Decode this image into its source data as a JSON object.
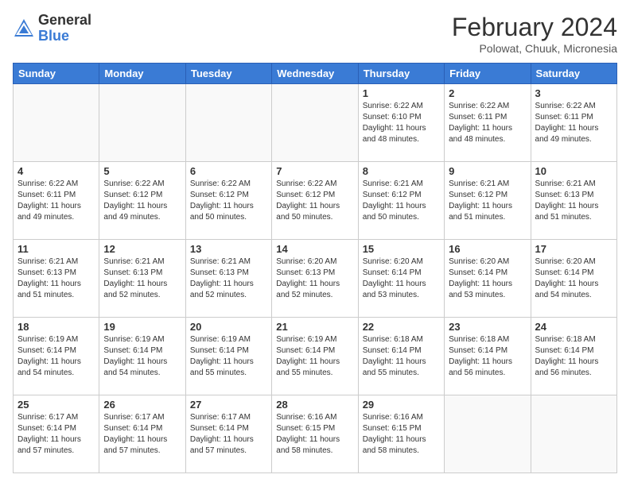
{
  "logo": {
    "general": "General",
    "blue": "Blue"
  },
  "title": {
    "month_year": "February 2024",
    "location": "Polowat, Chuuk, Micronesia"
  },
  "days_of_week": [
    "Sunday",
    "Monday",
    "Tuesday",
    "Wednesday",
    "Thursday",
    "Friday",
    "Saturday"
  ],
  "weeks": [
    [
      {
        "day": "",
        "content": ""
      },
      {
        "day": "",
        "content": ""
      },
      {
        "day": "",
        "content": ""
      },
      {
        "day": "",
        "content": ""
      },
      {
        "day": "1",
        "content": "Sunrise: 6:22 AM\nSunset: 6:10 PM\nDaylight: 11 hours and 48 minutes."
      },
      {
        "day": "2",
        "content": "Sunrise: 6:22 AM\nSunset: 6:11 PM\nDaylight: 11 hours and 48 minutes."
      },
      {
        "day": "3",
        "content": "Sunrise: 6:22 AM\nSunset: 6:11 PM\nDaylight: 11 hours and 49 minutes."
      }
    ],
    [
      {
        "day": "4",
        "content": "Sunrise: 6:22 AM\nSunset: 6:11 PM\nDaylight: 11 hours and 49 minutes."
      },
      {
        "day": "5",
        "content": "Sunrise: 6:22 AM\nSunset: 6:12 PM\nDaylight: 11 hours and 49 minutes."
      },
      {
        "day": "6",
        "content": "Sunrise: 6:22 AM\nSunset: 6:12 PM\nDaylight: 11 hours and 50 minutes."
      },
      {
        "day": "7",
        "content": "Sunrise: 6:22 AM\nSunset: 6:12 PM\nDaylight: 11 hours and 50 minutes."
      },
      {
        "day": "8",
        "content": "Sunrise: 6:21 AM\nSunset: 6:12 PM\nDaylight: 11 hours and 50 minutes."
      },
      {
        "day": "9",
        "content": "Sunrise: 6:21 AM\nSunset: 6:12 PM\nDaylight: 11 hours and 51 minutes."
      },
      {
        "day": "10",
        "content": "Sunrise: 6:21 AM\nSunset: 6:13 PM\nDaylight: 11 hours and 51 minutes."
      }
    ],
    [
      {
        "day": "11",
        "content": "Sunrise: 6:21 AM\nSunset: 6:13 PM\nDaylight: 11 hours and 51 minutes."
      },
      {
        "day": "12",
        "content": "Sunrise: 6:21 AM\nSunset: 6:13 PM\nDaylight: 11 hours and 52 minutes."
      },
      {
        "day": "13",
        "content": "Sunrise: 6:21 AM\nSunset: 6:13 PM\nDaylight: 11 hours and 52 minutes."
      },
      {
        "day": "14",
        "content": "Sunrise: 6:20 AM\nSunset: 6:13 PM\nDaylight: 11 hours and 52 minutes."
      },
      {
        "day": "15",
        "content": "Sunrise: 6:20 AM\nSunset: 6:14 PM\nDaylight: 11 hours and 53 minutes."
      },
      {
        "day": "16",
        "content": "Sunrise: 6:20 AM\nSunset: 6:14 PM\nDaylight: 11 hours and 53 minutes."
      },
      {
        "day": "17",
        "content": "Sunrise: 6:20 AM\nSunset: 6:14 PM\nDaylight: 11 hours and 54 minutes."
      }
    ],
    [
      {
        "day": "18",
        "content": "Sunrise: 6:19 AM\nSunset: 6:14 PM\nDaylight: 11 hours and 54 minutes."
      },
      {
        "day": "19",
        "content": "Sunrise: 6:19 AM\nSunset: 6:14 PM\nDaylight: 11 hours and 54 minutes."
      },
      {
        "day": "20",
        "content": "Sunrise: 6:19 AM\nSunset: 6:14 PM\nDaylight: 11 hours and 55 minutes."
      },
      {
        "day": "21",
        "content": "Sunrise: 6:19 AM\nSunset: 6:14 PM\nDaylight: 11 hours and 55 minutes."
      },
      {
        "day": "22",
        "content": "Sunrise: 6:18 AM\nSunset: 6:14 PM\nDaylight: 11 hours and 55 minutes."
      },
      {
        "day": "23",
        "content": "Sunrise: 6:18 AM\nSunset: 6:14 PM\nDaylight: 11 hours and 56 minutes."
      },
      {
        "day": "24",
        "content": "Sunrise: 6:18 AM\nSunset: 6:14 PM\nDaylight: 11 hours and 56 minutes."
      }
    ],
    [
      {
        "day": "25",
        "content": "Sunrise: 6:17 AM\nSunset: 6:14 PM\nDaylight: 11 hours and 57 minutes."
      },
      {
        "day": "26",
        "content": "Sunrise: 6:17 AM\nSunset: 6:14 PM\nDaylight: 11 hours and 57 minutes."
      },
      {
        "day": "27",
        "content": "Sunrise: 6:17 AM\nSunset: 6:14 PM\nDaylight: 11 hours and 57 minutes."
      },
      {
        "day": "28",
        "content": "Sunrise: 6:16 AM\nSunset: 6:15 PM\nDaylight: 11 hours and 58 minutes."
      },
      {
        "day": "29",
        "content": "Sunrise: 6:16 AM\nSunset: 6:15 PM\nDaylight: 11 hours and 58 minutes."
      },
      {
        "day": "",
        "content": ""
      },
      {
        "day": "",
        "content": ""
      }
    ]
  ]
}
